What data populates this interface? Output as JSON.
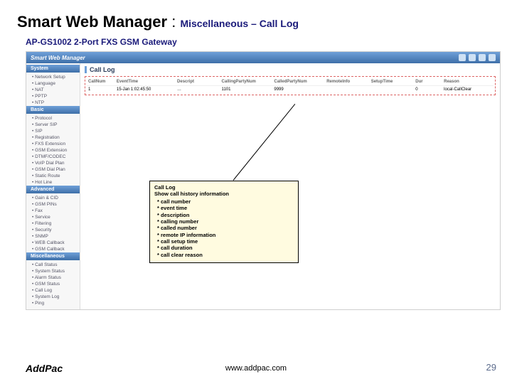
{
  "slide": {
    "title_main": "Smart Web Manager",
    "separator": " : ",
    "title_crumb": "Miscellaneous – Call Log",
    "subtitle": "AP-GS1002 2-Port FXS GSM Gateway"
  },
  "header": {
    "app_name": "Smart Web Manager"
  },
  "sidebar": {
    "sections": [
      {
        "head": "System",
        "items": [
          "Network Setup",
          "Language",
          "NAT",
          "PPTP",
          "NTP"
        ]
      },
      {
        "head": "Basic",
        "items": [
          "Protocol",
          "Server SIP",
          "SIP",
          "Registration",
          "FXS Extension",
          "GSM Extension",
          "DTMF/CODEC",
          "VoIP Dial Plan",
          "GSM Dial Plan",
          "Static Route",
          "Hot Line"
        ]
      },
      {
        "head": "Advanced",
        "items": [
          "Gain & CID",
          "GSM PINs",
          "Fax",
          "Service",
          "Filtering",
          "Security",
          "SNMP",
          "WEB Callback",
          "GSM Callback"
        ]
      },
      {
        "head": "Miscellaneous",
        "items": [
          "Call Status",
          "System Status",
          "Alarm Status",
          "GSM Status",
          "Call Log",
          "System Log",
          "Ping"
        ]
      }
    ]
  },
  "content": {
    "title": "Call Log",
    "columns": [
      "CallNum",
      "EventTime",
      "Descript",
      "CallingPartyNum",
      "CalledPartyNum",
      "RemoteInfo",
      "SetupTime",
      "Dur",
      "Reason"
    ],
    "rows": [
      [
        "1",
        "15-Jan 1:02:45:50",
        "…",
        "1101",
        "9999",
        "",
        "",
        "0",
        "local-CallClear"
      ]
    ]
  },
  "callout": {
    "title": "Call Log",
    "subtitle": "Show  call history information",
    "items": [
      "call number",
      "event time",
      "description",
      "calling number",
      "called number",
      "remote IP information",
      "call setup time",
      "call duration",
      "call clear reason"
    ]
  },
  "footer": {
    "logo": "AddPac",
    "url": "www.addpac.com",
    "page": "29"
  }
}
